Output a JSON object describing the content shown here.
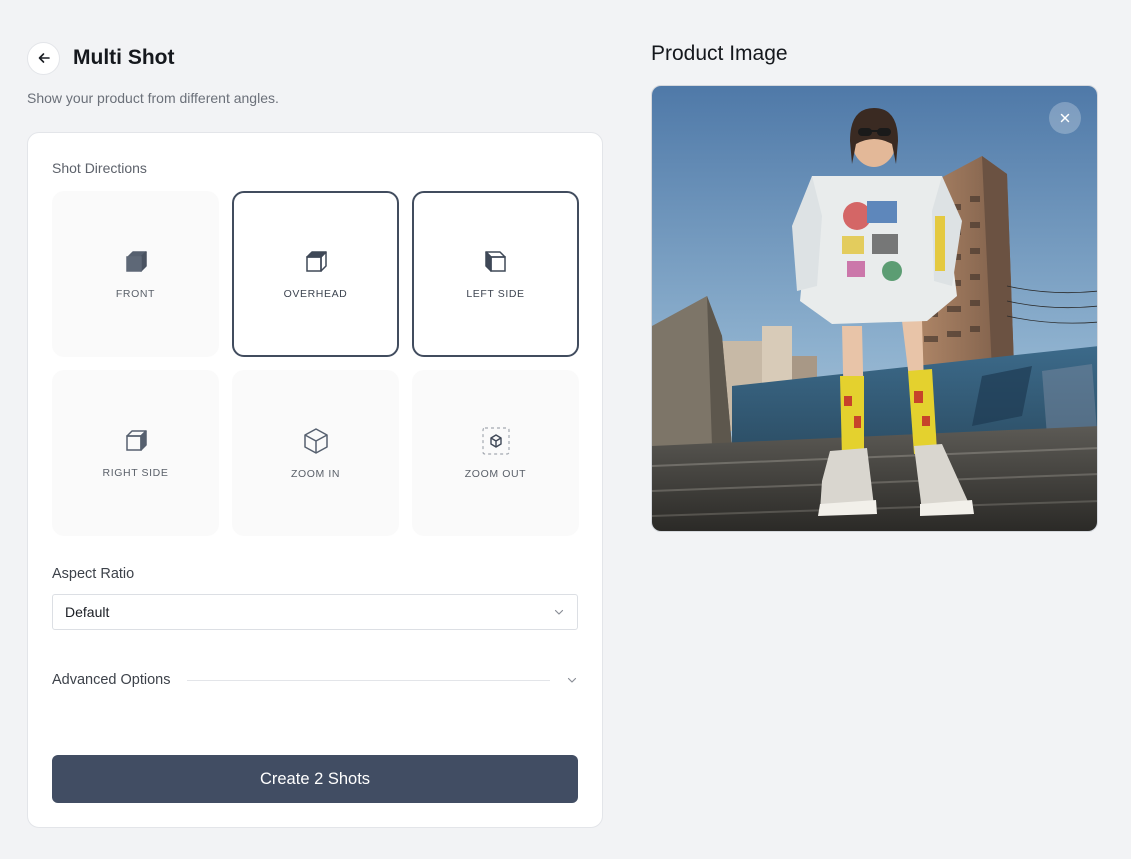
{
  "header": {
    "title": "Multi Shot",
    "subtitle": "Show your product from different angles."
  },
  "shot_directions": {
    "label": "Shot Directions",
    "tiles": [
      {
        "label": "FRONT",
        "icon": "cube-front-icon",
        "selected": false
      },
      {
        "label": "OVERHEAD",
        "icon": "cube-overhead-icon",
        "selected": true
      },
      {
        "label": "LEFT SIDE",
        "icon": "cube-left-side-icon",
        "selected": true
      },
      {
        "label": "RIGHT SIDE",
        "icon": "cube-right-side-icon",
        "selected": false
      },
      {
        "label": "ZOOM IN",
        "icon": "cube-zoom-in-icon",
        "selected": false
      },
      {
        "label": "ZOOM OUT",
        "icon": "cube-zoom-out-icon",
        "selected": false
      }
    ]
  },
  "aspect_ratio": {
    "label": "Aspect Ratio",
    "value": "Default"
  },
  "advanced": {
    "label": "Advanced Options"
  },
  "create_button": {
    "label": "Create 2 Shots"
  },
  "product_image": {
    "title": "Product Image"
  },
  "colors": {
    "accent": "#414d63",
    "background": "#f2f3f5",
    "selected_border": "#414c5e"
  }
}
